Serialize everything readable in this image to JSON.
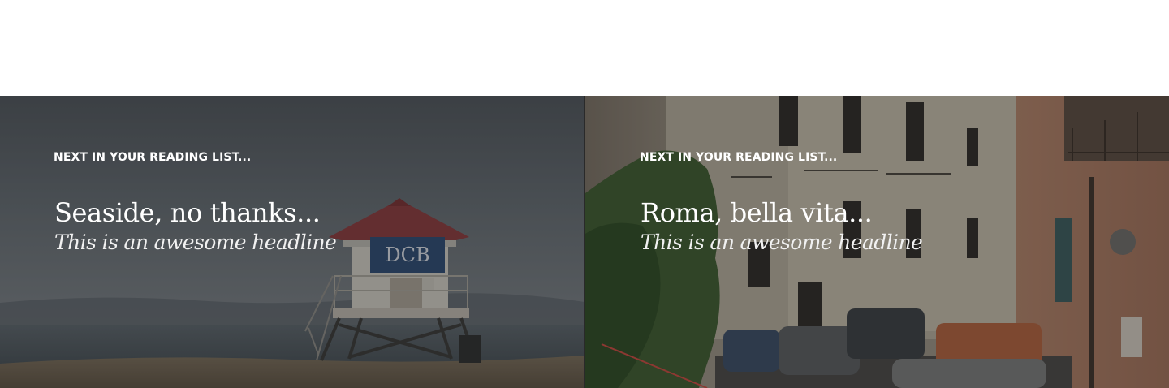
{
  "reading_list": {
    "cards": [
      {
        "eyebrow": "NEXT IN YOUR READING LIST...",
        "title": "Seaside, no thanks...",
        "subtitle": "This is an awesome headline",
        "image": "beach-lifeguard-tower-photo"
      },
      {
        "eyebrow": "NEXT IN YOUR READING LIST...",
        "title": "Roma, bella vita...",
        "subtitle": "This is an awesome headline",
        "image": "rome-street-photo"
      }
    ]
  },
  "colors": {
    "text": "#ffffff",
    "page_background": "#ffffff"
  }
}
